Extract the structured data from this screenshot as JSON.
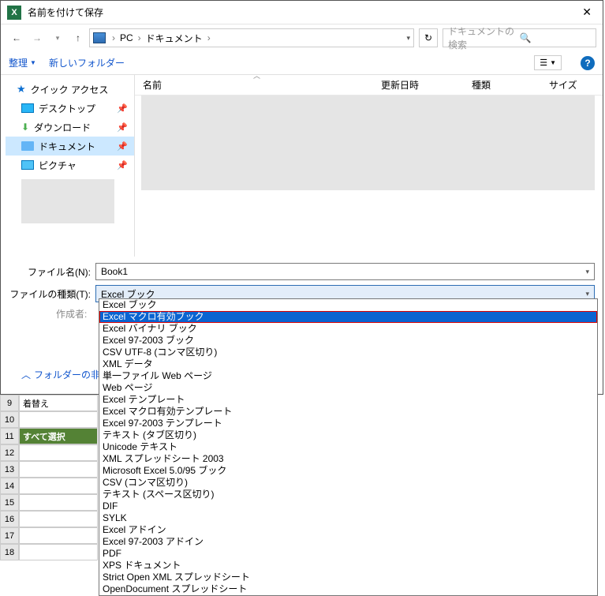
{
  "title": "名前を付けて保存",
  "breadcrumb": {
    "root": "PC",
    "folder": "ドキュメント"
  },
  "search_placeholder": "ドキュメントの検索",
  "toolbar": {
    "organize": "整理",
    "new_folder": "新しいフォルダー"
  },
  "sidebar": {
    "quick_access": "クイック アクセス",
    "desktop": "デスクトップ",
    "downloads": "ダウンロード",
    "documents": "ドキュメント",
    "pictures": "ピクチャ"
  },
  "columns": {
    "name": "名前",
    "date": "更新日時",
    "type": "種類",
    "size": "サイズ"
  },
  "filename_label": "ファイル名(N):",
  "filename_value": "Book1",
  "filetype_label": "ファイルの種類(T):",
  "filetype_value": "Excel ブック",
  "author_label": "作成者:",
  "hide_folders": "フォルダーの非表示",
  "filetypes": [
    "Excel ブック",
    "Excel マクロ有効ブック",
    "Excel バイナリ ブック",
    "Excel 97-2003 ブック",
    "CSV UTF-8 (コンマ区切り)",
    "XML データ",
    "単一ファイル Web ページ",
    "Web ページ",
    "Excel テンプレート",
    "Excel マクロ有効テンプレート",
    "Excel 97-2003 テンプレート",
    "テキスト (タブ区切り)",
    "Unicode テキスト",
    "XML スプレッドシート 2003",
    "Microsoft Excel 5.0/95 ブック",
    "CSV (コンマ区切り)",
    "テキスト (スペース区切り)",
    "DIF",
    "SYLK",
    "Excel アドイン",
    "Excel 97-2003 アドイン",
    "PDF",
    "XPS ドキュメント",
    "Strict Open XML スプレッドシート",
    "OpenDocument スプレッドシート"
  ],
  "highlighted_index": 1,
  "sheet": {
    "r9": "着替え",
    "r11": "すべて選択",
    "rows": [
      "9",
      "10",
      "11",
      "12",
      "13",
      "14",
      "15",
      "16",
      "17",
      "18"
    ]
  }
}
